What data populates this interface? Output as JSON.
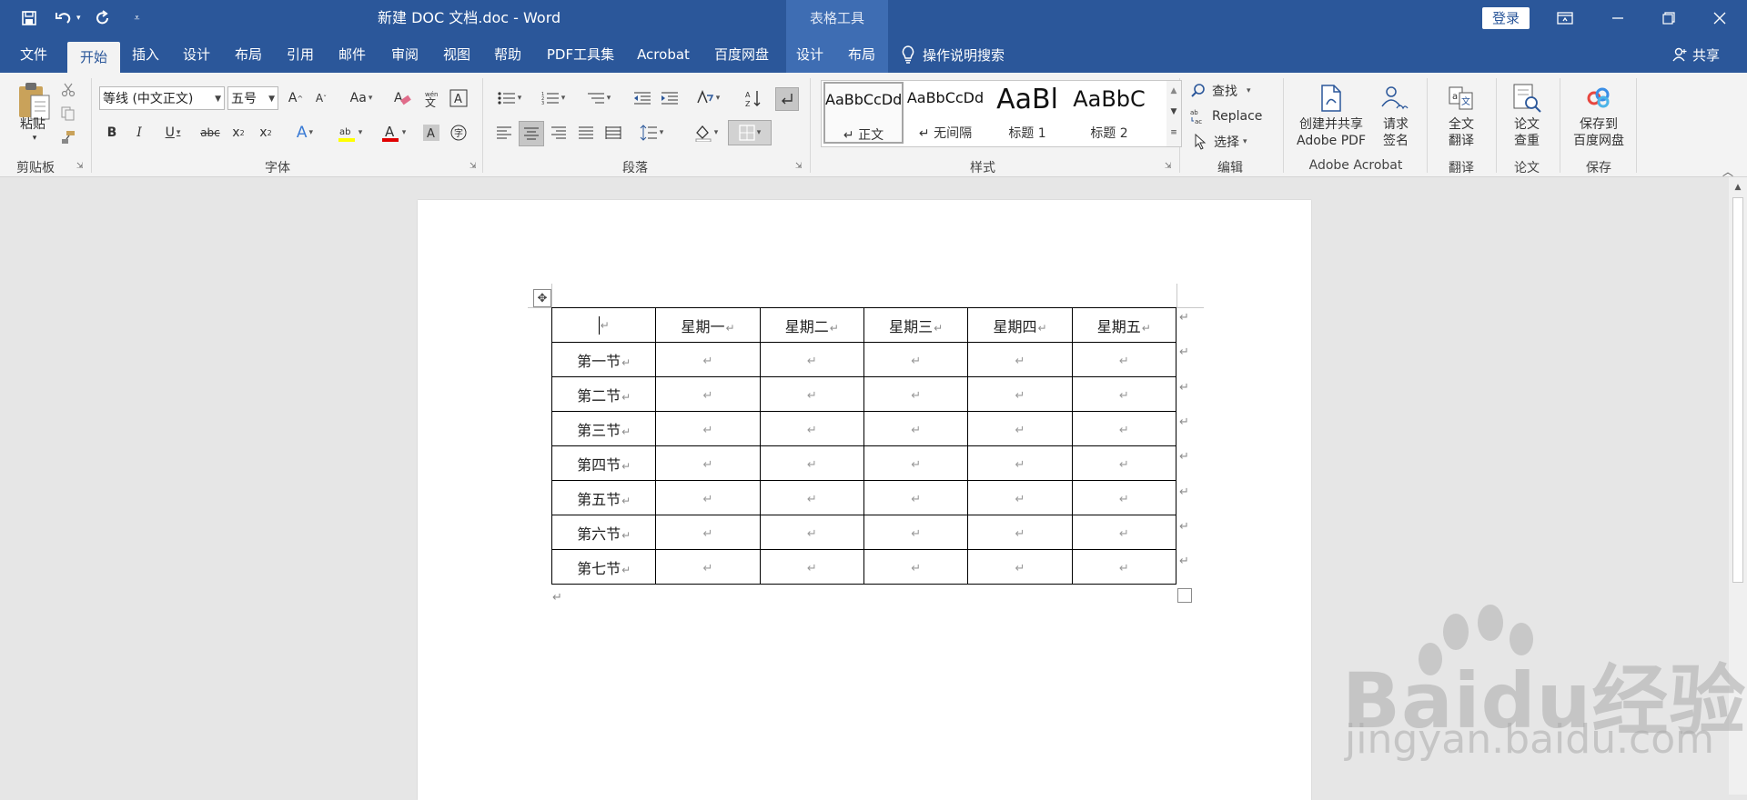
{
  "titlebar": {
    "doc_title": "新建 DOC 文档.doc  -  Word",
    "context_tools": "表格工具",
    "login": "登录",
    "qat": {
      "save_icon": "save-icon",
      "undo_icon": "undo-icon",
      "redo_icon": "redo-icon",
      "customize_icon": "customize-qat-icon"
    }
  },
  "tabs": [
    {
      "label": "文件"
    },
    {
      "label": "开始"
    },
    {
      "label": "插入"
    },
    {
      "label": "设计"
    },
    {
      "label": "布局"
    },
    {
      "label": "引用"
    },
    {
      "label": "邮件"
    },
    {
      "label": "审阅"
    },
    {
      "label": "视图"
    },
    {
      "label": "帮助"
    },
    {
      "label": "PDF工具集"
    },
    {
      "label": "Acrobat"
    },
    {
      "label": "百度网盘"
    },
    {
      "label": "设计"
    },
    {
      "label": "布局"
    }
  ],
  "active_tab": "开始",
  "tellme": "操作说明搜索",
  "share": "共享",
  "ribbon": {
    "clipboard": {
      "paste": "粘贴",
      "label": "剪贴板"
    },
    "font": {
      "name": "等线 (中文正文)",
      "size": "五号",
      "label": "字体"
    },
    "paragraph": {
      "label": "段落"
    },
    "styles": {
      "label": "样式",
      "items": [
        {
          "sample": "AaBbCcDd",
          "name": "↵ 正文"
        },
        {
          "sample": "AaBbCcDd",
          "name": "↵ 无间隔"
        },
        {
          "sample": "AaBl",
          "name": "标题 1"
        },
        {
          "sample": "AaBbC",
          "name": "标题 2"
        }
      ]
    },
    "editing": {
      "find": "查找",
      "replace": "Replace",
      "select": "选择",
      "label": "编辑"
    },
    "acrobat": {
      "create_line1": "创建并共享",
      "create_line2": "Adobe PDF",
      "sign_line1": "请求",
      "sign_line2": "签名",
      "label": "Adobe Acrobat"
    },
    "translate": {
      "btn_line1": "全文",
      "btn_line2": "翻译",
      "label": "翻译"
    },
    "paper": {
      "btn_line1": "论文",
      "btn_line2": "查重",
      "label": "论文"
    },
    "save": {
      "btn_line1": "保存到",
      "btn_line2": "百度网盘",
      "label": "保存"
    }
  },
  "table": {
    "header": [
      "",
      "星期一",
      "星期二",
      "星期三",
      "星期四",
      "星期五"
    ],
    "rows": [
      "第一节",
      "第二节",
      "第三节",
      "第四节",
      "第五节",
      "第六节",
      "第七节"
    ],
    "mark": "↵"
  },
  "watermark": {
    "big": "Baidu经验",
    "small": "jingyan.baidu.com"
  },
  "colors": {
    "brand": "#2b579a",
    "ribbon_bg": "#f3f3f3",
    "page": "#ffffff",
    "canvas": "#e6e6e6"
  }
}
